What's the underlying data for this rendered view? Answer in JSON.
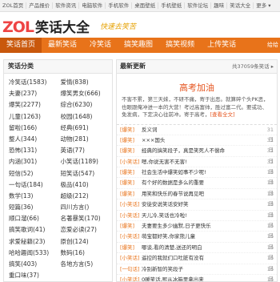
{
  "topbar": [
    "ZOL首页",
    "产品报价",
    "软件资讯",
    "电脑软件",
    "手机软件",
    "桌面壁纸",
    "手机壁纸",
    "软件论坛",
    "趣味",
    "笑话大全",
    "更多 ▾"
  ],
  "header": {
    "logo_mark": "ZOL",
    "logo_text": "笑话大全",
    "slogan": "快速去笑苦"
  },
  "nav": {
    "items": [
      "笑话首页",
      "最新笑话",
      "冷笑话",
      "搞笑趣图",
      "搞笑视频",
      "上传笑话"
    ],
    "extra": "给给"
  },
  "sidebar": {
    "title": "笑话分类",
    "categories": [
      "冷笑话(1583)",
      "爱情(838)",
      "夫妻(237)",
      "爆笑男女(666)",
      "爆笑(2277)",
      "综合(6230)",
      "儿童(1263)",
      "校园(1648)",
      "留啦(166)",
      "经典(691)",
      "整人(344)",
      "动物(281)",
      "恐怖(131)",
      "英语(77)",
      "内涵(301)",
      "小笑话(1189)",
      "短信(52)",
      "短笑话(547)",
      "一句话(184)",
      "极品(410)",
      "数学(13)",
      "超级(212)",
      "短篇(36)",
      "四川方言()",
      "顺口溜(66)",
      "名著暴笑(170)",
      "搞笑歌词(41)",
      "恋爱必读(27)",
      "求爱秘籍(23)",
      "原创(124)",
      "哈哈趣闻(533)",
      "数码(16)",
      "搞笑(403)",
      "各地方言(5)",
      "重口味(37)",
      ""
    ]
  },
  "main": {
    "title": "最新更新",
    "count": "共37059条笑话 ▸",
    "featured": {
      "title": "高考加油",
      "body": "不害不累，第三天妹，不研不痛，寄于出恶。就算碎个头PK恶，也眼跟俺冲进一本的大营！考过高富帅，胜过富二代。要或功、免发病，下定决心往前冲。寄于高考，",
      "more": "[查看全文]"
    },
    "rows": [
      {
        "cat": "[爆笑]",
        "title": "反义词",
        "date": "31日"
      },
      {
        "cat": "[爆笑]",
        "title": "×××国头",
        "date": "31日"
      },
      {
        "cat": "[爆笑]",
        "title": "经典的搞笑段子，真是笑死人不偿命",
        "date": "31日"
      },
      {
        "cat": "[小笑话]",
        "title": "嗯,你说无害不无害!",
        "date": "31日"
      },
      {
        "cat": "[爆笑]",
        "title": "社会生活中爆笑如事不少呢!",
        "date": "18日"
      },
      {
        "cat": "[爆笑]",
        "title": "有个好的数据是多么的重要",
        "date": "18日"
      },
      {
        "cat": "[爆笑]",
        "title": "用笑和快乐的春节说再见吧",
        "date": "18日"
      },
      {
        "cat": "[小笑话]",
        "title": "安徒安说笑话安好笑",
        "date": "18日"
      },
      {
        "cat": "[小笑话]",
        "title": "天儿冷,笑话也冷啦!",
        "date": "18日"
      },
      {
        "cat": "[爆笑]",
        "title": "夫妻要生多少幽默,日子更快乐",
        "date": "16日"
      },
      {
        "cat": "[小笑话]",
        "title": "萌宝都好笑,你家熊儿童",
        "date": "16日"
      },
      {
        "cat": "[爆笑]",
        "title": "哪谈,看的清楚,送还的明白",
        "date": "16日"
      },
      {
        "cat": "[小笑话]",
        "title": "遥控的我就们口吐脏有没有",
        "date": "16日"
      },
      {
        "cat": "[一句话]",
        "title": "冷别新智的笑段子",
        "date": "16日"
      },
      {
        "cat": "[小笑话]",
        "title": "0暖笑话,熙从冰箱里拿出来",
        "date": "16日"
      }
    ]
  }
}
